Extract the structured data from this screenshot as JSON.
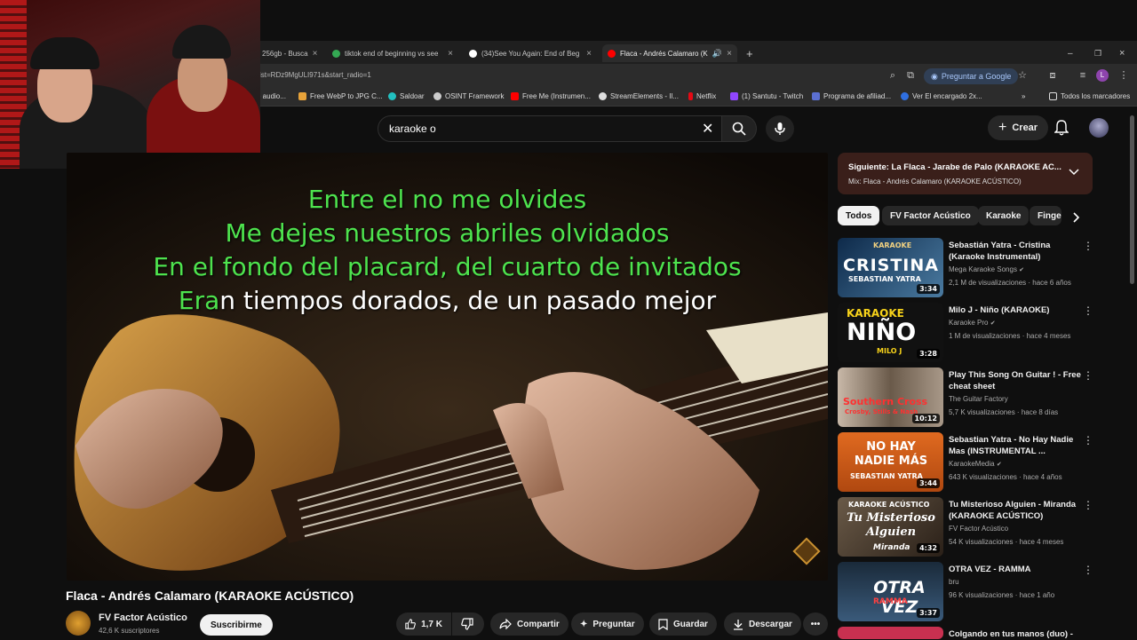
{
  "tabs": [
    {
      "label": "256gb - Busca",
      "color": "#4285f4"
    },
    {
      "label": "tiktok end of beginning vs see",
      "color": "#34a853"
    },
    {
      "label": "(34)See You Again: End of Beg",
      "color": "#ffffff"
    },
    {
      "label": "Flaca - Andrés Calamaro (K",
      "color": "#ff0000"
    }
  ],
  "address": {
    "url": "ist=RDz9MgULI971s&start_radio=1",
    "gemini_label": "Preguntar a Google",
    "profile_initial": "L"
  },
  "bookmarks": [
    {
      "label": "e audio...",
      "color": "#888888"
    },
    {
      "label": "Free WebP to JPG C...",
      "color": "#e8a33a"
    },
    {
      "label": "Saldoar",
      "color": "#22c0c0"
    },
    {
      "label": "OSINT Framework",
      "color": "#cccccc"
    },
    {
      "label": "Free Me (Instrumen...",
      "color": "#ff0000"
    },
    {
      "label": "StreamElements - Il...",
      "color": "#dddddd"
    },
    {
      "label": "Netflix",
      "color": "#e50914"
    },
    {
      "label": "(1) Santutu - Twitch",
      "color": "#9146ff"
    },
    {
      "label": "Programa de afiliad...",
      "color": "#5b6fd1"
    },
    {
      "label": "Ver El encargado 2x...",
      "color": "#2f6fe0"
    }
  ],
  "bookmarks_all": "Todos los marcadores",
  "search": {
    "value": "karaoke o"
  },
  "header": {
    "create_label": "Crear"
  },
  "lyrics": [
    {
      "highlight": "Entre el no me olvides",
      "rest": ""
    },
    {
      "highlight": "Me dejes nuestros abriles olvidados",
      "rest": ""
    },
    {
      "highlight": "En el fondo del placard, del cuarto de invitados",
      "rest": ""
    },
    {
      "highlight": "Era",
      "rest": "n tiempos dorados, de un pasado mejor"
    }
  ],
  "video": {
    "title": "Flaca - Andrés Calamaro (KARAOKE ACÚSTICO)",
    "channel": "FV Factor Acústico",
    "subscribers": "42,6 K suscriptores",
    "subscribe_label": "Suscribirme",
    "likes": "1,7 K",
    "share_label": "Compartir",
    "ask_label": "Preguntar",
    "save_label": "Guardar",
    "download_label": "Descargar"
  },
  "next": {
    "title": "Siguiente: La Flaca - Jarabe de Palo (KARAOKE AC...",
    "sub": "Mix: Flaca - Andrés Calamaro (KARAOKE ACÚSTICO)"
  },
  "chips": [
    "Todos",
    "FV Factor Acústico",
    "Karaoke",
    "Finge"
  ],
  "recommendations": [
    {
      "title": "Sebastián Yatra - Cristina (Karaoke Instrumental)",
      "channel": "Mega Karaoke Songs",
      "verified": true,
      "views": "2,1 M de visualizaciones · hace 6 años",
      "duration": "3:34",
      "thumb_text": "CRISTINA",
      "thumb_sub": "SEBASTIAN YATRA",
      "thumb_top": "KARAOKE",
      "thumb_bg": "#1a3a5a"
    },
    {
      "title": "Milo J - Niño (KARAOKE)",
      "channel": "Karaoke Pro",
      "verified": true,
      "views": "1 M de visualizaciones · hace 4 meses",
      "duration": "3:28",
      "thumb_text": "NIÑO",
      "thumb_sub": "MILO J",
      "thumb_top": "KARAOKE",
      "thumb_bg": "#1a1a1a"
    },
    {
      "title": "Play This Song On Guitar ! - Free cheat sheet",
      "channel": "The Guitar Factory",
      "verified": false,
      "views": "5,7 K visualizaciones · hace 8 días",
      "duration": "10:12",
      "thumb_text": "Southern Cross",
      "thumb_sub": "Crosby, Stills & Nash",
      "thumb_top": "",
      "thumb_bg": "#6a5a4a"
    },
    {
      "title": "Sebastian Yatra - No Hay Nadie Mas (INSTRUMENTAL ...",
      "channel": "KaraokeMedia",
      "verified": true,
      "views": "643 K visualizaciones · hace 4 años",
      "duration": "3:44",
      "thumb_text": "NO HAY NADIE MÁS",
      "thumb_sub": "SEBASTIAN YATRA",
      "thumb_top": "",
      "thumb_bg": "#c85a20"
    },
    {
      "title": "Tu Misterioso Alguien - Miranda (KARAOKE ACÚSTICO)",
      "channel": "FV Factor Acústico",
      "verified": false,
      "views": "54 K visualizaciones · hace 4 meses",
      "duration": "4:32",
      "thumb_text": "Tu Misterioso Alguien",
      "thumb_sub": "Miranda",
      "thumb_top": "KARAOKE ACÚSTICO",
      "thumb_bg": "#4a3a2a"
    },
    {
      "title": "OTRA VEZ - RAMMA",
      "channel": "bru",
      "verified": false,
      "views": "96 K visualizaciones · hace 1 año",
      "duration": "3:37",
      "thumb_text": "OTRA VEZ",
      "thumb_sub": "RAMMA",
      "thumb_top": "",
      "thumb_bg": "#2a3a4a"
    },
    {
      "title": "Colgando en tus manos (duo) -",
      "channel": "",
      "verified": false,
      "views": "",
      "duration": "",
      "thumb_text": "",
      "thumb_sub": "",
      "thumb_top": "",
      "thumb_bg": "#c83050"
    }
  ],
  "colors": {
    "accent": "#ff0000",
    "lyric_highlight": "#4ee34e",
    "next_box": "#3a1f1a"
  },
  "icons": [
    "search-icon",
    "clear-icon",
    "mic-icon",
    "plus-icon",
    "bell-icon",
    "like-icon",
    "dislike-icon",
    "share-icon",
    "sparkle-icon",
    "bookmark-icon",
    "download-icon",
    "more-icon",
    "chevron-down-icon",
    "chevron-right-icon"
  ]
}
